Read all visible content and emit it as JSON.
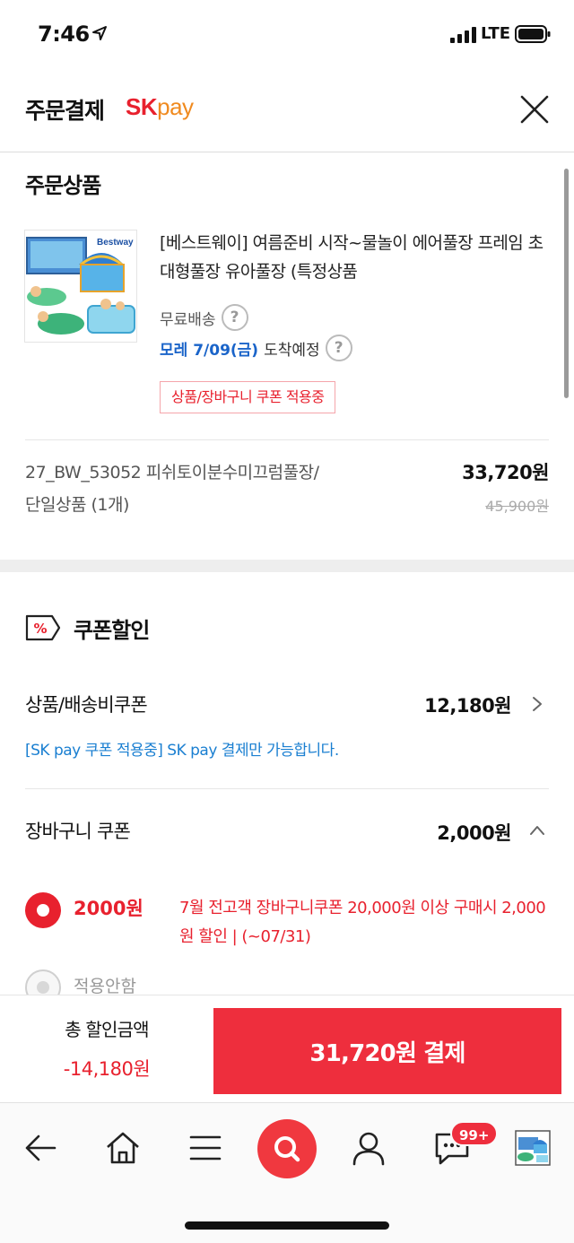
{
  "status_bar": {
    "time": "7:46",
    "network": "LTE"
  },
  "header": {
    "title": "주문결제",
    "brand_sk": "SK",
    "brand_pay": "pay"
  },
  "order": {
    "section_title": "주문상품",
    "product_name": "[베스트웨이] 여름준비 시작~물놀이 에어풀장 프레임 초대형풀장 유아풀장 (특정상품",
    "thumb_brand": "Bestway",
    "shipping": "무료배송",
    "arrival_date": "모레 7/09(금)",
    "arrival_suffix": "도착예정",
    "help_symbol": "?",
    "coupon_tag": "상품/장바구니 쿠폰 적용중",
    "option_line1": "27_BW_53052 피쉬토이분수미끄럼풀장/",
    "option_line2": "단일상품 (1개)",
    "price": "33,720원",
    "original_price": "45,900원"
  },
  "coupon": {
    "title": "쿠폰할인",
    "product_coupon_label": "상품/배송비쿠폰",
    "product_coupon_value": "12,180원",
    "sk_note": "[SK pay 쿠폰 적용중] SK pay 결제만 가능합니다.",
    "cart_coupon_label": "장바구니 쿠폰",
    "cart_coupon_value": "2,000원",
    "options": [
      {
        "amount": "2000원",
        "desc": "7월 전고객 장바구니쿠폰 20,000원 이상 구매시 2,000원 할인 | (~07/31)",
        "selected": true
      },
      {
        "label": "적용안함",
        "selected": false
      }
    ]
  },
  "payment": {
    "total_label": "총 할인금액",
    "total_value": "-14,180원",
    "pay_button": "31,720원 결제"
  },
  "toolbar": {
    "badge": "99+"
  },
  "colors": {
    "accent": "#ee2e3d",
    "link_blue": "#1a64c9",
    "note_blue": "#1a7fd1"
  }
}
